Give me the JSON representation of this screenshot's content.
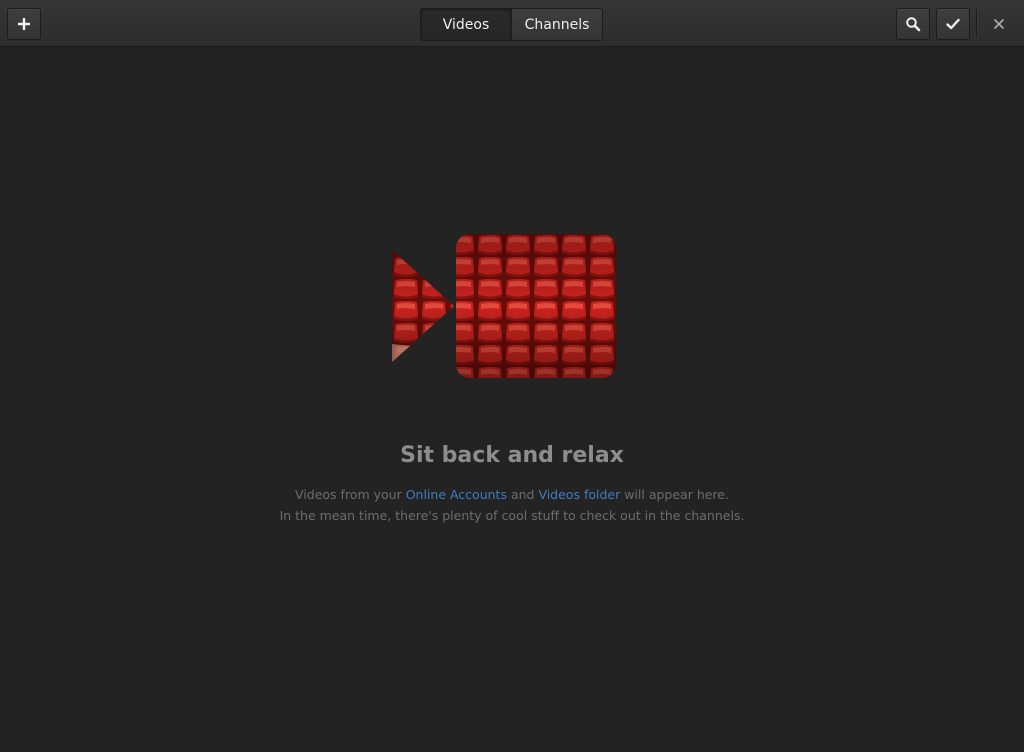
{
  "header": {
    "add_icon": "plus-icon",
    "tabs": [
      {
        "label": "Videos",
        "active": true
      },
      {
        "label": "Channels",
        "active": false
      }
    ],
    "search_icon": "search-icon",
    "select_icon": "checkmark-icon",
    "close_icon": "close-icon"
  },
  "empty_state": {
    "illustration": "video-camera-theater-seats-icon",
    "title": "Sit back and relax",
    "line1": {
      "prefix": "Videos from your ",
      "link1": "Online Accounts",
      "middle": " and ",
      "link2": "Videos folder",
      "suffix": " will appear here."
    },
    "line2": "In the mean time, there's plenty of cool stuff to check out in the channels."
  },
  "colors": {
    "background": "#232323",
    "link": "#3f7dc3",
    "seat_red": "#c8231d"
  }
}
